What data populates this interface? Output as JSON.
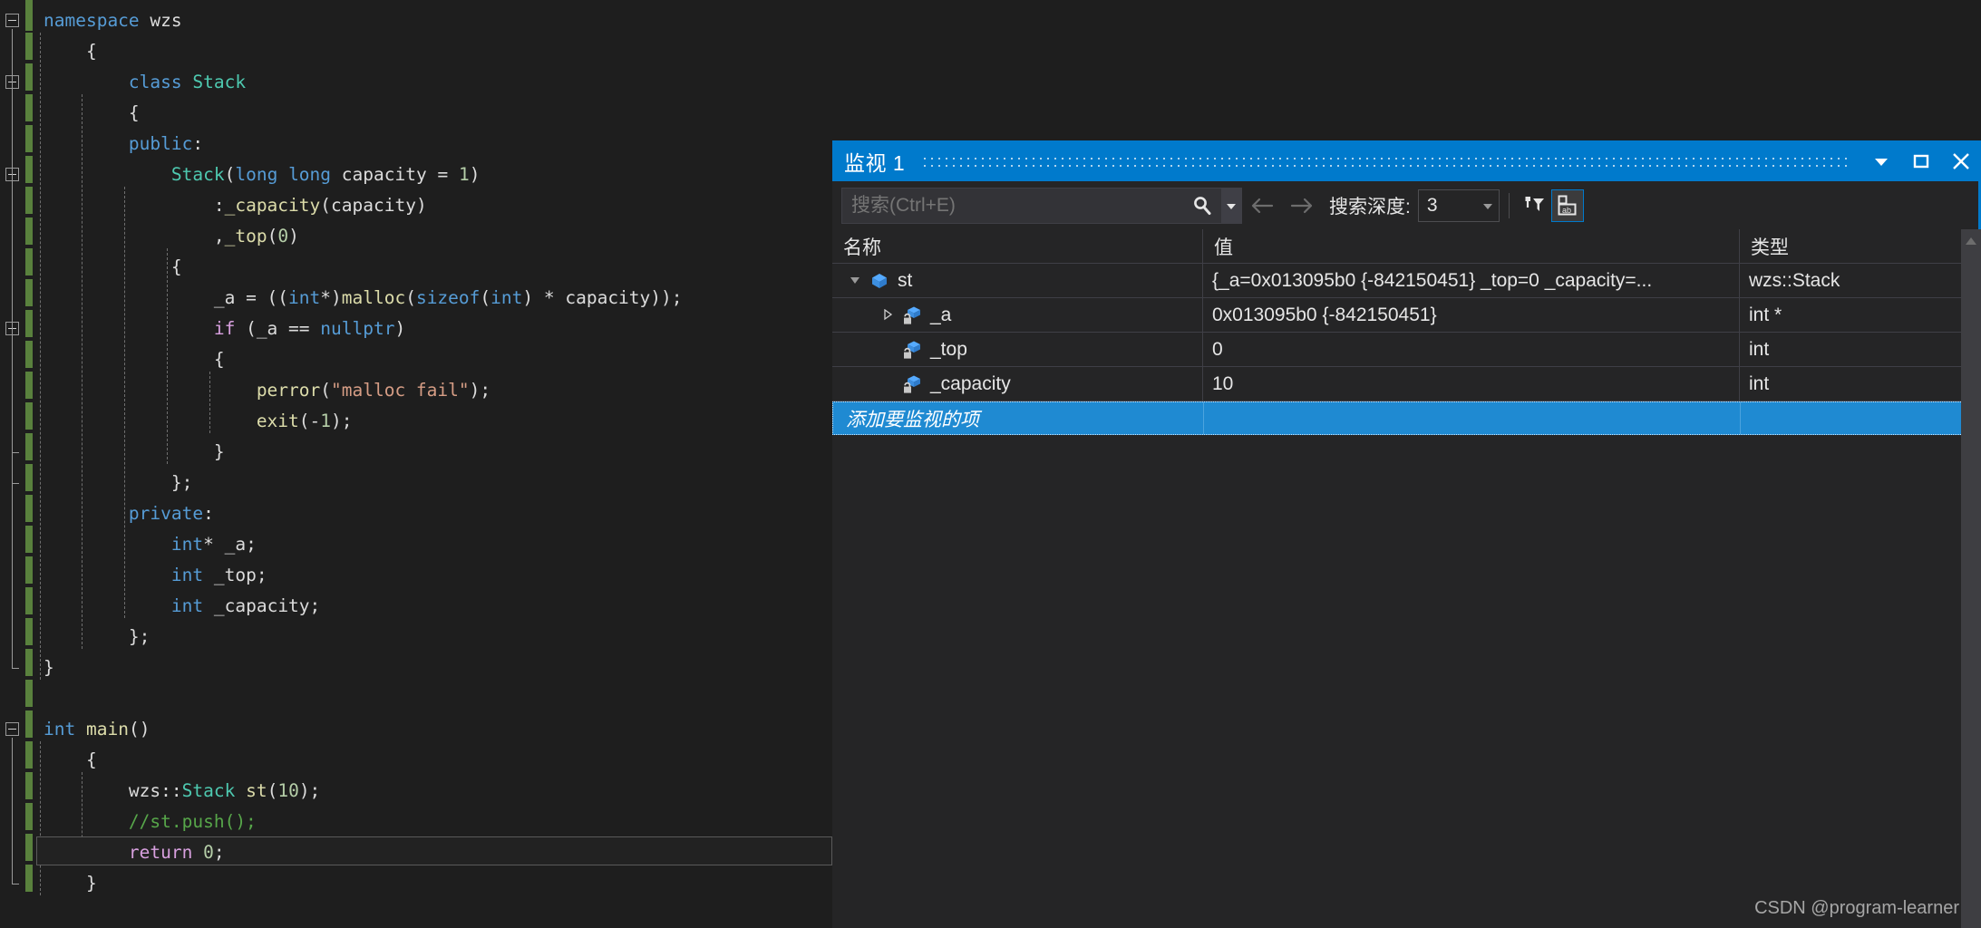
{
  "editor": {
    "name": "code-editor",
    "language": "cpp",
    "lines": [
      {
        "indent": 0,
        "fold": true,
        "text": "namespace wzs"
      },
      {
        "indent": 1,
        "fold": false,
        "text": "{"
      },
      {
        "indent": 2,
        "fold": true,
        "text": "class Stack"
      },
      {
        "indent": 2,
        "fold": false,
        "text": "{"
      },
      {
        "indent": 2,
        "fold": false,
        "text": "public:"
      },
      {
        "indent": 3,
        "fold": true,
        "text": "Stack(long long capacity = 1)"
      },
      {
        "indent": 4,
        "fold": false,
        "text": ":_capacity(capacity)"
      },
      {
        "indent": 4,
        "fold": false,
        "text": ",_top(0)"
      },
      {
        "indent": 3,
        "fold": false,
        "text": "{"
      },
      {
        "indent": 4,
        "fold": false,
        "text": "_a = ((int*)malloc(sizeof(int) * capacity));"
      },
      {
        "indent": 4,
        "fold": true,
        "text": "if (_a == nullptr)"
      },
      {
        "indent": 4,
        "fold": false,
        "text": "{"
      },
      {
        "indent": 5,
        "fold": false,
        "text": "perror(\"malloc fail\");"
      },
      {
        "indent": 5,
        "fold": false,
        "text": "exit(-1);"
      },
      {
        "indent": 4,
        "fold": false,
        "text": "}"
      },
      {
        "indent": 3,
        "fold": false,
        "text": "};"
      },
      {
        "indent": 2,
        "fold": false,
        "text": "private:"
      },
      {
        "indent": 3,
        "fold": false,
        "text": "int* _a;"
      },
      {
        "indent": 3,
        "fold": false,
        "text": "int _top;"
      },
      {
        "indent": 3,
        "fold": false,
        "text": "int _capacity;"
      },
      {
        "indent": 2,
        "fold": false,
        "text": "};"
      },
      {
        "indent": 0,
        "fold": false,
        "text": "}"
      },
      {
        "indent": 0,
        "fold": false,
        "text": ""
      },
      {
        "indent": 0,
        "fold": true,
        "text": "int main()"
      },
      {
        "indent": 1,
        "fold": false,
        "text": "{"
      },
      {
        "indent": 2,
        "fold": false,
        "text": "wzs::Stack st(10);"
      },
      {
        "indent": 2,
        "fold": false,
        "text": "//st.push();"
      },
      {
        "indent": 2,
        "fold": false,
        "text": "return 0;"
      },
      {
        "indent": 1,
        "fold": false,
        "text": "}"
      }
    ],
    "current_line_index": 27
  },
  "watch": {
    "title": "监视 1",
    "window_buttons": {
      "dropdown": "chevron-down-icon",
      "maximize": "maximize-icon",
      "close": "close-icon"
    },
    "toolbar": {
      "search_placeholder": "搜索(Ctrl+E)",
      "search_value": "",
      "search_icon": "search-icon",
      "search_dropdown_icon": "chevron-down-icon",
      "prev_icon": "arrow-left-icon",
      "next_icon": "arrow-right-icon",
      "depth_label": "搜索深度:",
      "depth_value": "3",
      "depth_caret_icon": "chevron-down-icon",
      "filter_icon": "pin-filter-icon",
      "hex_icon": "ab-display-icon"
    },
    "columns": [
      "名称",
      "值",
      "类型"
    ],
    "rows": [
      {
        "name": "st",
        "value": "{_a=0x013095b0 {-842150451} _top=0 _capacity=...",
        "type": "wzs::Stack",
        "depth": 0,
        "expander": "expanded",
        "icon": "object-cube-icon"
      },
      {
        "name": "_a",
        "value": "0x013095b0 {-842150451}",
        "type": "int *",
        "depth": 1,
        "expander": "collapsed",
        "icon": "private-field-icon"
      },
      {
        "name": "_top",
        "value": "0",
        "type": "int",
        "depth": 1,
        "expander": "none",
        "icon": "private-field-icon"
      },
      {
        "name": "_capacity",
        "value": "10",
        "type": "int",
        "depth": 1,
        "expander": "none",
        "icon": "private-field-icon"
      }
    ],
    "add_row": {
      "name": "添加要监视的项",
      "value": "",
      "type": ""
    },
    "scrollbar": {
      "up_icon": "scroll-up-icon"
    }
  },
  "watermark": "CSDN @program-learner",
  "colors": {
    "accent": "#007acc",
    "editor_bg": "#1e1e1e",
    "panel_bg": "#252526",
    "selection": "#1f8ad2",
    "change_bar": "#59813d"
  }
}
